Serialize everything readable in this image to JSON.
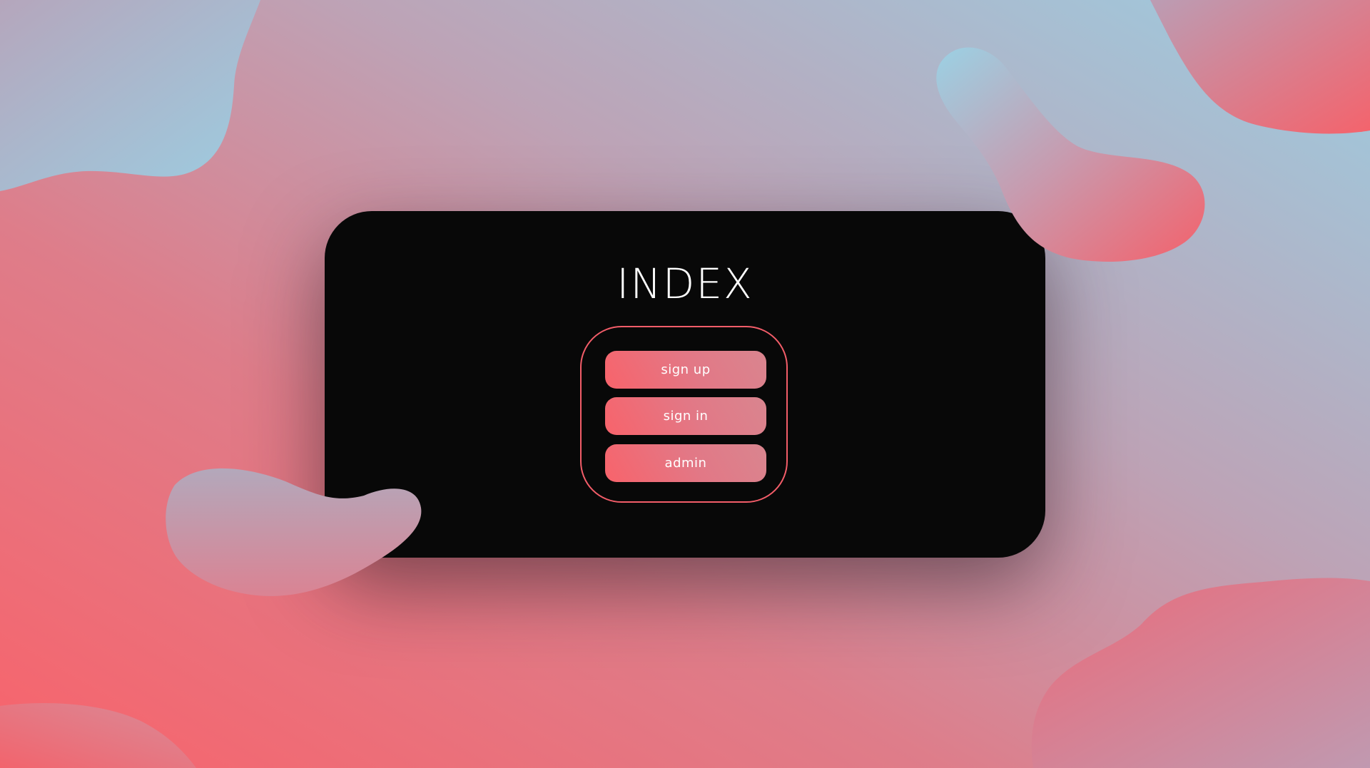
{
  "page": {
    "title": "INDEX"
  },
  "menu": {
    "items": [
      {
        "label": "sign up"
      },
      {
        "label": "sign in"
      },
      {
        "label": "admin"
      }
    ]
  },
  "colors": {
    "background_coral": "#f8636b",
    "background_sky": "#9ccde1",
    "card": "#080808",
    "accent_border": "#f35d69",
    "text": "#ffffff"
  }
}
